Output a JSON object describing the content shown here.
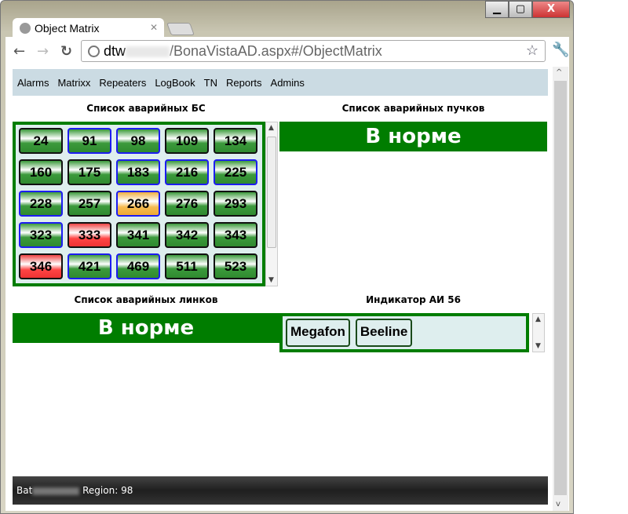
{
  "browser": {
    "tab_title": "Object Matrix",
    "url_host": "dtw",
    "url_path": "/BonaVistaAD.aspx#/ObjectMatrix"
  },
  "menu": [
    "Alarms",
    "Matrixx",
    "Repeaters",
    "LogBook",
    "TN",
    "Reports",
    "Admins"
  ],
  "bs_panel": {
    "title": "Список аварийных БС",
    "items": [
      {
        "label": "24",
        "state": "ok",
        "border": "black"
      },
      {
        "label": "91",
        "state": "ok",
        "border": "blue"
      },
      {
        "label": "98",
        "state": "ok",
        "border": "blue"
      },
      {
        "label": "109",
        "state": "ok",
        "border": "black"
      },
      {
        "label": "134",
        "state": "ok",
        "border": "black"
      },
      {
        "label": "160",
        "state": "ok",
        "border": "black"
      },
      {
        "label": "175",
        "state": "ok",
        "border": "black"
      },
      {
        "label": "183",
        "state": "ok",
        "border": "blue"
      },
      {
        "label": "216",
        "state": "ok",
        "border": "blue"
      },
      {
        "label": "225",
        "state": "ok",
        "border": "blue"
      },
      {
        "label": "228",
        "state": "ok",
        "border": "blue"
      },
      {
        "label": "257",
        "state": "ok",
        "border": "black"
      },
      {
        "label": "266",
        "state": "warning",
        "border": "blue"
      },
      {
        "label": "276",
        "state": "ok",
        "border": "black"
      },
      {
        "label": "293",
        "state": "ok",
        "border": "black"
      },
      {
        "label": "323",
        "state": "ok",
        "border": "blue"
      },
      {
        "label": "333",
        "state": "alarm",
        "border": "black"
      },
      {
        "label": "341",
        "state": "ok",
        "border": "black"
      },
      {
        "label": "342",
        "state": "ok",
        "border": "black"
      },
      {
        "label": "343",
        "state": "ok",
        "border": "black"
      },
      {
        "label": "346",
        "state": "alarm",
        "border": "black"
      },
      {
        "label": "421",
        "state": "ok",
        "border": "blue"
      },
      {
        "label": "469",
        "state": "ok",
        "border": "blue"
      },
      {
        "label": "511",
        "state": "ok",
        "border": "black"
      },
      {
        "label": "523",
        "state": "ok",
        "border": "black"
      }
    ]
  },
  "bundles_panel": {
    "title": "Список аварийных пучков",
    "status": "В норме"
  },
  "links_panel": {
    "title": "Список аварийных линков",
    "status": "В норме"
  },
  "ai_panel": {
    "title": "Индикатор АИ 56",
    "operators": [
      "Megafon",
      "Beeline"
    ]
  },
  "footer": {
    "user_visible": "Bat",
    "region_label": "Region:",
    "region_value": "98"
  },
  "colors": {
    "ok_green": "#007d00",
    "alarm_red": "#f04444",
    "warning_orange": "#f6bb50",
    "menu_bg": "#cbdbe3"
  }
}
